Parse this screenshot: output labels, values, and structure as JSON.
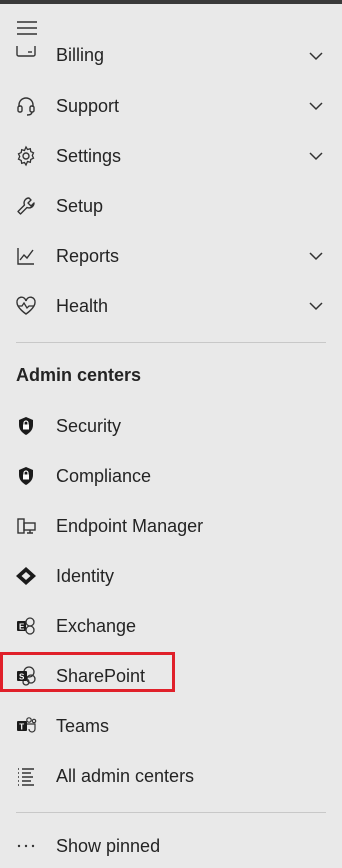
{
  "nav": {
    "items_top": [
      {
        "label": "Billing",
        "icon": "billing-icon",
        "chevron": true
      },
      {
        "label": "Support",
        "icon": "headset-icon",
        "chevron": true
      },
      {
        "label": "Settings",
        "icon": "gear-icon",
        "chevron": true
      },
      {
        "label": "Setup",
        "icon": "wrench-icon",
        "chevron": false
      },
      {
        "label": "Reports",
        "icon": "chart-line-icon",
        "chevron": true
      },
      {
        "label": "Health",
        "icon": "heart-pulse-icon",
        "chevron": true
      }
    ],
    "admin_section_title": "Admin centers",
    "admin_items": [
      {
        "label": "Security",
        "icon": "shield-lock-icon"
      },
      {
        "label": "Compliance",
        "icon": "shield-lock-icon"
      },
      {
        "label": "Endpoint Manager",
        "icon": "device-icon"
      },
      {
        "label": "Identity",
        "icon": "identity-diamond-icon"
      },
      {
        "label": "Exchange",
        "icon": "exchange-icon"
      },
      {
        "label": "SharePoint",
        "icon": "sharepoint-icon"
      },
      {
        "label": "Teams",
        "icon": "teams-icon"
      },
      {
        "label": "All admin centers",
        "icon": "list-icon"
      }
    ],
    "show_pinned": {
      "label": "Show pinned",
      "icon": "more-dots-icon"
    }
  },
  "highlight": {
    "target": "SharePoint",
    "color": "#e0202a"
  }
}
